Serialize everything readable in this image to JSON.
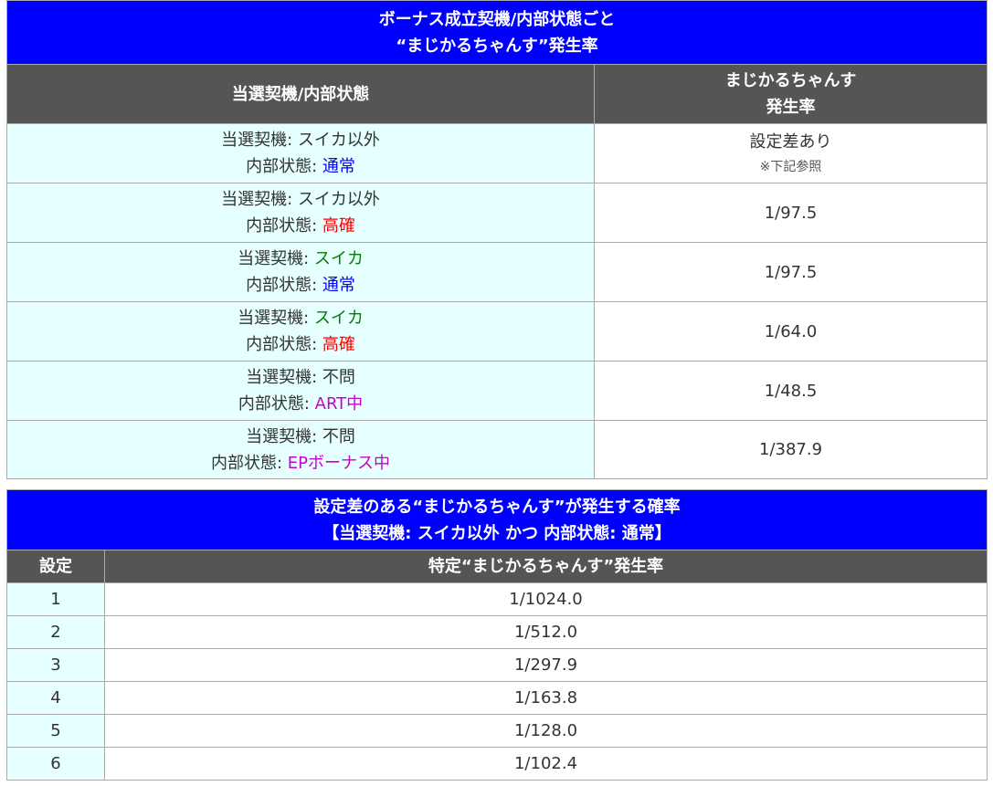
{
  "table1": {
    "title": [
      "ボーナス成立契機/内部状態ごと",
      "“まじかるちゃんす”発生率"
    ],
    "col_headers": {
      "left": "当選契機/内部状態",
      "right": [
        "まじかるちゃんす",
        "発生率"
      ]
    },
    "rows": [
      {
        "trigger_label": "当選契機: ",
        "trigger": "スイカ以外",
        "trigger_color": "#333333",
        "state_label": "内部状態: ",
        "state": "通常",
        "state_color": "#0000ff",
        "rate": "設定差あり",
        "note": "※下記参照"
      },
      {
        "trigger_label": "当選契機: ",
        "trigger": "スイカ以外",
        "trigger_color": "#333333",
        "state_label": "内部状態: ",
        "state": "高確",
        "state_color": "#ff0000",
        "rate": "1/97.5",
        "note": ""
      },
      {
        "trigger_label": "当選契機: ",
        "trigger": "スイカ",
        "trigger_color": "#008000",
        "state_label": "内部状態: ",
        "state": "通常",
        "state_color": "#0000ff",
        "rate": "1/97.5",
        "note": ""
      },
      {
        "trigger_label": "当選契機: ",
        "trigger": "スイカ",
        "trigger_color": "#008000",
        "state_label": "内部状態: ",
        "state": "高確",
        "state_color": "#ff0000",
        "rate": "1/64.0",
        "note": ""
      },
      {
        "trigger_label": "当選契機: ",
        "trigger": "不問",
        "trigger_color": "#333333",
        "state_label": "内部状態: ",
        "state": "ART中",
        "state_color": "#cc00cc",
        "rate": "1/48.5",
        "note": ""
      },
      {
        "trigger_label": "当選契機: ",
        "trigger": "不問",
        "trigger_color": "#333333",
        "state_label": "内部状態: ",
        "state": "EPボーナス中",
        "state_color": "#cc00cc",
        "rate": "1/387.9",
        "note": ""
      }
    ]
  },
  "table2": {
    "title": [
      "設定差のある“まじかるちゃんす”が発生する確率",
      "【当選契機: スイカ以外 かつ 内部状態: 通常】"
    ],
    "col_headers": {
      "left": "設定",
      "right": "特定“まじかるちゃんす”発生率"
    },
    "rows": [
      {
        "setting": "1",
        "rate": "1/1024.0"
      },
      {
        "setting": "2",
        "rate": "1/512.0"
      },
      {
        "setting": "3",
        "rate": "1/297.9"
      },
      {
        "setting": "4",
        "rate": "1/163.8"
      },
      {
        "setting": "5",
        "rate": "1/128.0"
      },
      {
        "setting": "6",
        "rate": "1/102.4"
      }
    ]
  },
  "colors": {
    "title_bg": "#0000ff",
    "header_bg": "#555555",
    "left_cell_bg": "#e6ffff"
  }
}
